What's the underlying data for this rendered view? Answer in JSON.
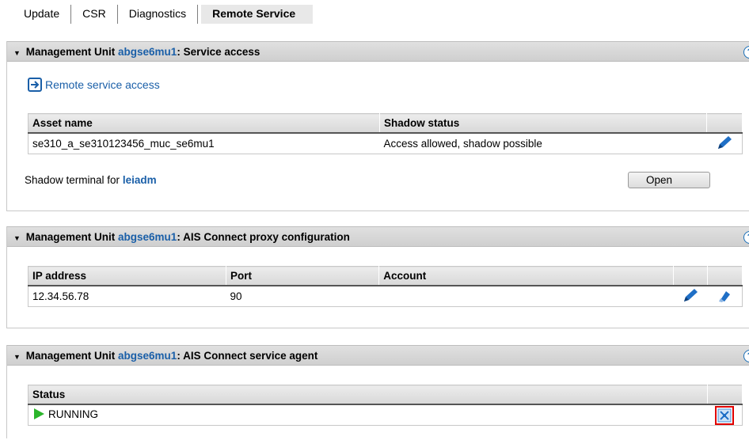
{
  "tabs": [
    "Update",
    "CSR",
    "Diagnostics",
    "Remote Service"
  ],
  "panel1": {
    "title_prefix": "Management Unit ",
    "unit": "abgse6mu1",
    "title_suffix": ": Service access",
    "remote_link": "Remote service access",
    "columns": [
      "Asset name",
      "Shadow status"
    ],
    "row": {
      "asset": "se310_a_se310123456_muc_se6mu1",
      "status": "Access allowed, shadow possible"
    },
    "shadow_label": "Shadow terminal for ",
    "shadow_user": "leiadm",
    "open_button": "Open"
  },
  "panel2": {
    "title_prefix": "Management Unit ",
    "unit": "abgse6mu1",
    "title_suffix": ": AIS Connect proxy configuration",
    "columns": [
      "IP address",
      "Port",
      "Account"
    ],
    "row": {
      "ip": "12.34.56.78",
      "port": "90",
      "account": ""
    }
  },
  "panel3": {
    "title_prefix": "Management Unit ",
    "unit": "abgse6mu1",
    "title_suffix": ": AIS Connect service agent",
    "columns": [
      "Status"
    ],
    "row": {
      "status": "RUNNING"
    }
  },
  "help_symbol": "?",
  "colors": {
    "link": "#1a5fa8",
    "running": "#2bb52b",
    "highlight": "#e00000"
  }
}
